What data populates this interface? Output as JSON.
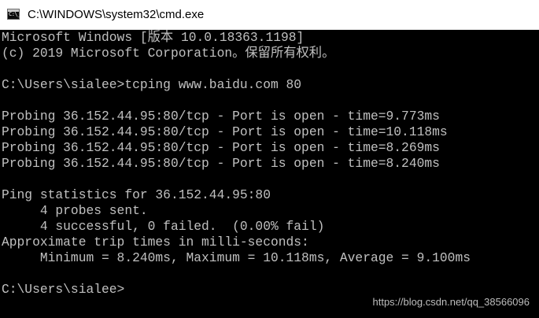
{
  "window": {
    "title": "C:\\WINDOWS\\system32\\cmd.exe",
    "icon": "cmd-console-icon",
    "icon_prompt": "C:\\_"
  },
  "console": {
    "lines": [
      "Microsoft Windows [版本 10.0.18363.1198]",
      "(c) 2019 Microsoft Corporation。保留所有权利。",
      "",
      "C:\\Users\\sialee>tcping www.baidu.com 80",
      "",
      "Probing 36.152.44.95:80/tcp - Port is open - time=9.773ms",
      "Probing 36.152.44.95:80/tcp - Port is open - time=10.118ms",
      "Probing 36.152.44.95:80/tcp - Port is open - time=8.269ms",
      "Probing 36.152.44.95:80/tcp - Port is open - time=8.240ms",
      "",
      "Ping statistics for 36.152.44.95:80",
      "     4 probes sent.",
      "     4 successful, 0 failed.  (0.00% fail)",
      "Approximate trip times in milli-seconds:",
      "     Minimum = 8.240ms, Maximum = 10.118ms, Average = 9.100ms",
      "",
      "C:\\Users\\sialee>"
    ]
  },
  "watermark": {
    "text": "https://blog.csdn.net/qq_38566096"
  },
  "colors": {
    "background": "#000000",
    "foreground": "#c0c0c0",
    "titlebar": "#ffffff",
    "watermark": "#bdbdbd"
  }
}
